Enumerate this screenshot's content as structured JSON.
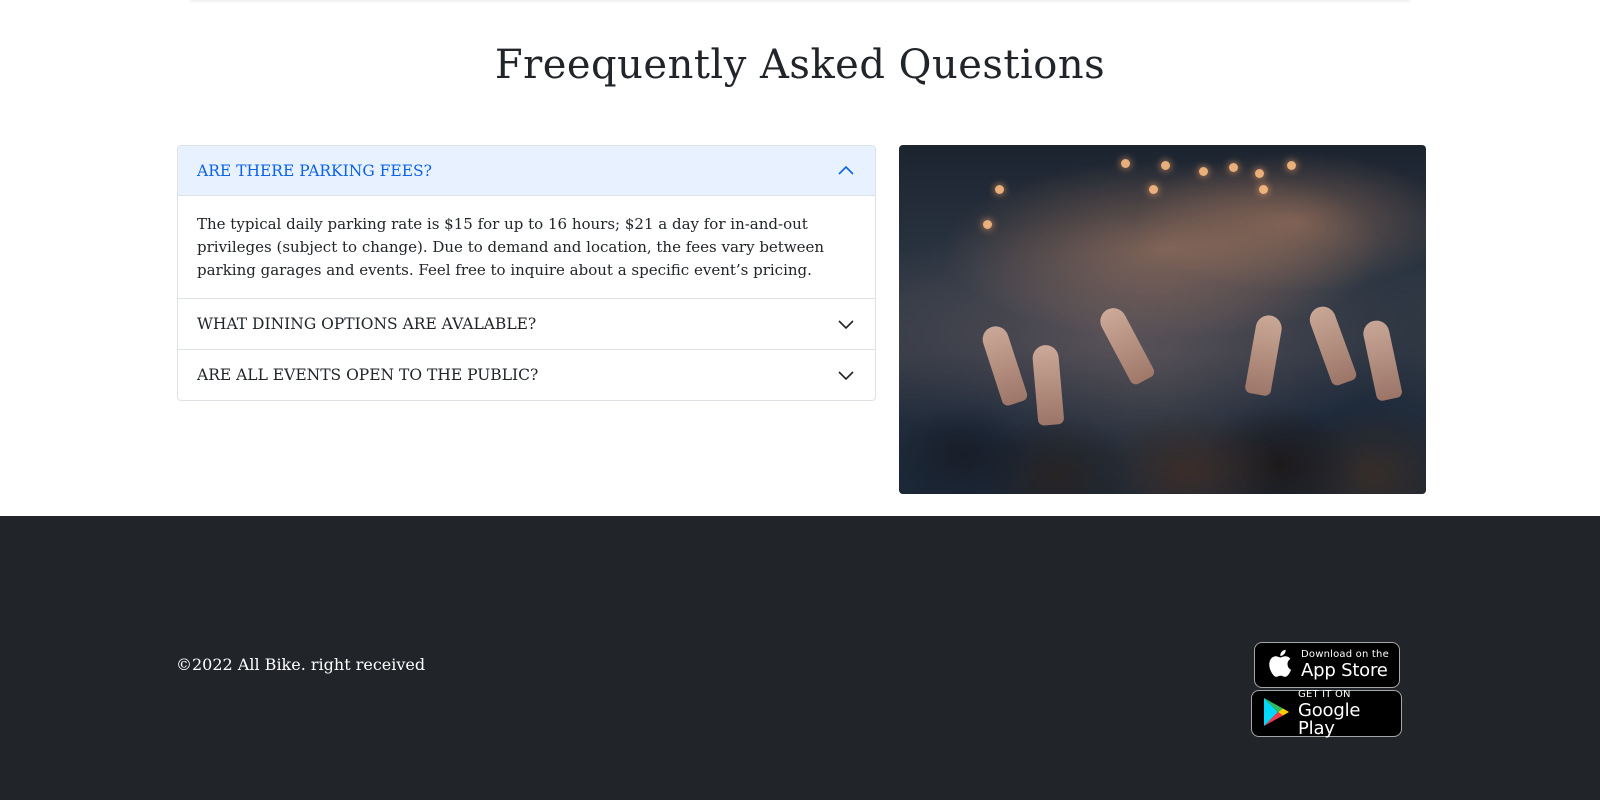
{
  "faq": {
    "title": "Freequently Asked Questions",
    "items": [
      {
        "question": "ARE THERE PARKING FEES?",
        "answer": "The typical daily parking rate is $15 for up to 16 hours; $21 a day for in-and-out privileges (subject to change). Due to demand and location, the fees vary between parking garages and events. Feel free to inquire about a specific event’s pricing.",
        "expanded": true
      },
      {
        "question": "WHAT DINING OPTIONS ARE AVALABLE?",
        "expanded": false
      },
      {
        "question": "ARE ALL EVENTS OPEN TO THE PUBLIC?",
        "expanded": false
      }
    ],
    "accent_color": "#0c63e4",
    "open_header_bg": "#e7f1ff"
  },
  "image": {
    "icon": "concert-crowd-photo"
  },
  "footer": {
    "copyright": "©2022 All Bike. right received",
    "background": "#212529",
    "app_store": {
      "small_text": "Download on the",
      "big_text": "App Store",
      "icon": "apple-icon"
    },
    "google_play": {
      "small_text": "GET IT ON",
      "big_text": "Google Play",
      "icon": "google-play-icon"
    }
  }
}
